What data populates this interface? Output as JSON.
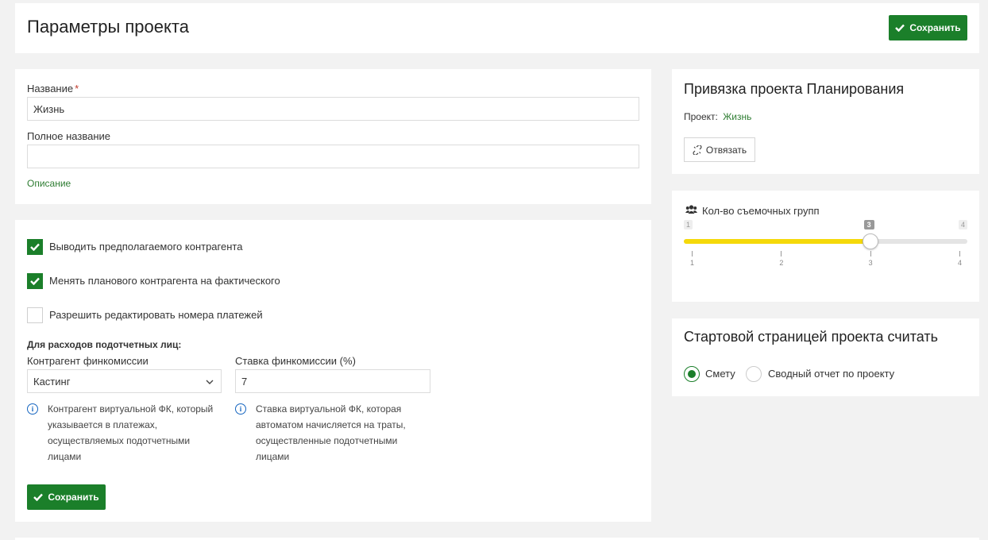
{
  "header": {
    "title": "Параметры проекта",
    "save_label": "Сохранить"
  },
  "form": {
    "name_label": "Название",
    "name_required": "*",
    "name_value": "Жизнь",
    "fullname_label": "Полное название",
    "fullname_value": "",
    "description_link": "Описание"
  },
  "options": {
    "checkboxes": [
      {
        "label": "Выводить предполагаемого контрагента",
        "checked": true
      },
      {
        "label": "Менять планового контрагента на фактического",
        "checked": true
      },
      {
        "label": "Разрешить редактировать номера платежей",
        "checked": false
      }
    ],
    "section_title": "Для расходов подотчетных лиц:",
    "counterparty_label": "Контрагент финкомиссии",
    "counterparty_value": "Кастинг",
    "rate_label": "Ставка финкомиссии (%)",
    "rate_value": "7",
    "counterparty_info": [
      "Контрагент виртуальной ФК, который",
      "указывается в платежах,",
      "осуществляемых подотчетными",
      "лицами"
    ],
    "rate_info": [
      "Ставка виртуальной ФК, которая",
      "автоматом начисляется на траты,",
      "осуществленные подотчетными",
      "лицами"
    ],
    "save_label": "Сохранить"
  },
  "planning": {
    "title": "Привязка проекта Планирования",
    "project_label": "Проект:",
    "project_value": "Жизнь",
    "unlink_label": "Отвязать"
  },
  "crews": {
    "title": "Кол-во съемочных групп",
    "min": 1,
    "max": 4,
    "value": 3,
    "min_label": "1",
    "max_label": "4",
    "value_label": "3",
    "ticks": [
      "1",
      "2",
      "3",
      "4"
    ],
    "accent": "#f5d90a"
  },
  "start_page": {
    "title": "Стартовой страницей проекта считать",
    "options": [
      {
        "label": "Смету",
        "checked": true
      },
      {
        "label": "Сводный отчет по проекту",
        "checked": false
      }
    ]
  },
  "colors": {
    "brand_green": "#1b7f2a",
    "info_blue": "#1565c0"
  }
}
